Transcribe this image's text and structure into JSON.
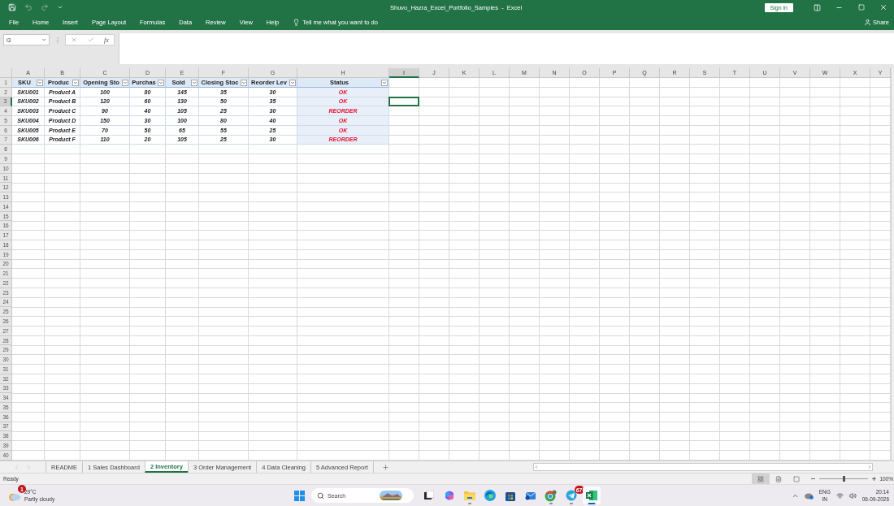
{
  "window": {
    "title": "Shuvo_Hazra_Excel_Portfolio_Samples  -  Excel",
    "sign_in": "Sign in"
  },
  "menu": [
    "File",
    "Home",
    "Insert",
    "Page Layout",
    "Formulas",
    "Data",
    "Review",
    "View",
    "Help"
  ],
  "tell_me": "Tell me what you want to do",
  "share": "Share",
  "formula_bar": {
    "name_box": "I3",
    "function_symbol": "fx"
  },
  "columns": [
    {
      "label": "A",
      "selected": false
    },
    {
      "label": "B",
      "selected": false
    },
    {
      "label": "C",
      "selected": false
    },
    {
      "label": "D",
      "selected": false
    },
    {
      "label": "E",
      "selected": false
    },
    {
      "label": "F",
      "selected": false
    },
    {
      "label": "G",
      "selected": false
    },
    {
      "label": "H",
      "selected": false
    },
    {
      "label": "I",
      "selected": true
    },
    {
      "label": "J",
      "selected": false
    },
    {
      "label": "K",
      "selected": false
    },
    {
      "label": "L",
      "selected": false
    },
    {
      "label": "M",
      "selected": false
    },
    {
      "label": "N",
      "selected": false
    },
    {
      "label": "O",
      "selected": false
    },
    {
      "label": "P",
      "selected": false
    },
    {
      "label": "Q",
      "selected": false
    },
    {
      "label": "R",
      "selected": false
    },
    {
      "label": "S",
      "selected": false
    },
    {
      "label": "T",
      "selected": false
    },
    {
      "label": "U",
      "selected": false
    },
    {
      "label": "V",
      "selected": false
    },
    {
      "label": "W",
      "selected": false
    },
    {
      "label": "X",
      "selected": false
    },
    {
      "label": "Y",
      "selected": false
    }
  ],
  "rows": [
    {
      "label": "1",
      "selected": false
    },
    {
      "label": "2",
      "selected": false
    },
    {
      "label": "3",
      "selected": true
    },
    {
      "label": "4",
      "selected": false
    },
    {
      "label": "5",
      "selected": false
    },
    {
      "label": "6",
      "selected": false
    },
    {
      "label": "7",
      "selected": false
    },
    {
      "label": "8",
      "selected": false
    },
    {
      "label": "9",
      "selected": false
    },
    {
      "label": "10",
      "selected": false
    },
    {
      "label": "11",
      "selected": false
    },
    {
      "label": "12",
      "selected": false
    },
    {
      "label": "13",
      "selected": false
    },
    {
      "label": "14",
      "selected": false
    },
    {
      "label": "15",
      "selected": false
    },
    {
      "label": "16",
      "selected": false
    },
    {
      "label": "17",
      "selected": false
    },
    {
      "label": "18",
      "selected": false
    },
    {
      "label": "19",
      "selected": false
    },
    {
      "label": "20",
      "selected": false
    },
    {
      "label": "21",
      "selected": false
    },
    {
      "label": "22",
      "selected": false
    },
    {
      "label": "23",
      "selected": false
    },
    {
      "label": "24",
      "selected": false
    },
    {
      "label": "25",
      "selected": false
    },
    {
      "label": "26",
      "selected": false
    },
    {
      "label": "27",
      "selected": false
    },
    {
      "label": "28",
      "selected": false
    },
    {
      "label": "29",
      "selected": false
    },
    {
      "label": "30",
      "selected": false
    },
    {
      "label": "31",
      "selected": false
    },
    {
      "label": "32",
      "selected": false
    },
    {
      "label": "33",
      "selected": false
    },
    {
      "label": "34",
      "selected": false
    },
    {
      "label": "35",
      "selected": false
    },
    {
      "label": "36",
      "selected": false
    },
    {
      "label": "37",
      "selected": false
    },
    {
      "label": "38",
      "selected": false
    },
    {
      "label": "39",
      "selected": false
    },
    {
      "label": "40",
      "selected": false
    }
  ],
  "table": {
    "headers": [
      "SKU",
      "Produc",
      "Opening Sto",
      "Purchas",
      "Sold",
      "Closing Stoc",
      "Reorder Lev",
      "Status"
    ],
    "rows": [
      [
        "SKU001",
        "Product A",
        "100",
        "80",
        "145",
        "35",
        "30",
        "OK"
      ],
      [
        "SKU002",
        "Product B",
        "120",
        "60",
        "130",
        "50",
        "35",
        "OK"
      ],
      [
        "SKU003",
        "Product C",
        "90",
        "40",
        "105",
        "25",
        "30",
        "REORDER"
      ],
      [
        "SKU004",
        "Product D",
        "150",
        "30",
        "100",
        "80",
        "40",
        "OK"
      ],
      [
        "SKU005",
        "Product E",
        "70",
        "50",
        "65",
        "55",
        "25",
        "OK"
      ],
      [
        "SKU006",
        "Product F",
        "110",
        "20",
        "105",
        "25",
        "30",
        "REORDER"
      ]
    ]
  },
  "sheet_tabs": [
    {
      "label": "README",
      "selected": false
    },
    {
      "label": "1 Sales Dashboard",
      "selected": false
    },
    {
      "label": "2 Inventory",
      "selected": true
    },
    {
      "label": "3 Order Management",
      "selected": false
    },
    {
      "label": "4 Data Cleaning",
      "selected": false
    },
    {
      "label": "5 Advanced Report",
      "selected": false
    }
  ],
  "status_bar": {
    "text": "Ready",
    "zoom": "100%",
    "zoom_slider": {
      "level": 0.5
    }
  },
  "taskbar": {
    "weather": {
      "badge": "1",
      "temperature": "29°C",
      "condition": "Partly cloudy"
    },
    "search": {
      "placeholder": "Search"
    },
    "apps": [
      {
        "kind": "task-view",
        "running": false,
        "active": false
      },
      {
        "kind": "copilot",
        "running": false,
        "active": false
      },
      {
        "kind": "files",
        "running": true,
        "active": false
      },
      {
        "kind": "edge",
        "running": false,
        "active": false
      },
      {
        "kind": "store",
        "running": false,
        "active": false
      },
      {
        "kind": "mail",
        "running": false,
        "active": false
      },
      {
        "kind": "chrome",
        "running": true,
        "active": false
      },
      {
        "kind": "telegram",
        "running": true,
        "active": false,
        "badge": "67"
      },
      {
        "kind": "excel",
        "running": true,
        "active": true
      }
    ],
    "language": [
      "ENG",
      "IN"
    ],
    "time": "20:14",
    "date": "06-09-2026"
  }
}
